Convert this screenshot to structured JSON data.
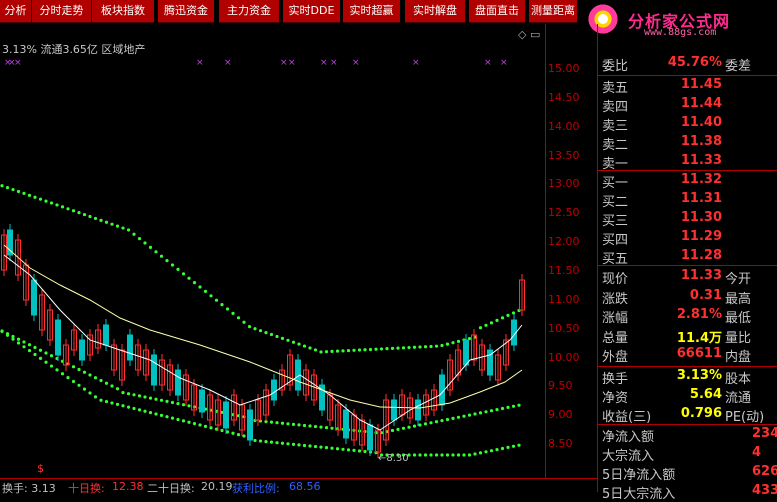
{
  "toolbar": {
    "buttons": [
      "分析",
      "分时走势",
      "板块指数",
      "腾迅资金",
      "主力资金",
      "实时DDE",
      "实时超赢",
      "实时解盘",
      "盘面直击",
      "测量距离"
    ]
  },
  "logo": {
    "title": "分析家公式网",
    "url": "www.88gs.com"
  },
  "info_line": "3.13% 流通3.65亿 区域地产",
  "axis_ticks": [
    "15.00",
    "14.50",
    "14.00",
    "13.50",
    "13.00",
    "12.50",
    "12.00",
    "11.50",
    "11.00",
    "10.50",
    "10.00",
    "9.50",
    "9.00",
    "8.50"
  ],
  "annotation": "←8.30",
  "panel": {
    "weibi": {
      "label": "委比",
      "value": "45.76%",
      "label2": "委差"
    },
    "asks": [
      {
        "label": "卖五",
        "price": "11.45"
      },
      {
        "label": "卖四",
        "price": "11.44"
      },
      {
        "label": "卖三",
        "price": "11.40"
      },
      {
        "label": "卖二",
        "price": "11.38"
      },
      {
        "label": "卖一",
        "price": "11.33"
      }
    ],
    "bids": [
      {
        "label": "买一",
        "price": "11.32"
      },
      {
        "label": "买二",
        "price": "11.31"
      },
      {
        "label": "买三",
        "price": "11.30"
      },
      {
        "label": "买四",
        "price": "11.29"
      },
      {
        "label": "买五",
        "price": "11.28"
      }
    ],
    "quote": [
      {
        "label": "现价",
        "value": "11.33",
        "label2": "今开",
        "color": "#ff3030"
      },
      {
        "label": "涨跌",
        "value": "0.31",
        "label2": "最高",
        "color": "#ff3030"
      },
      {
        "label": "涨幅",
        "value": "2.81%",
        "label2": "最低",
        "color": "#ff3030"
      },
      {
        "label": "总量",
        "value": "11.4万",
        "label2": "量比",
        "color": "#ffff00"
      },
      {
        "label": "外盘",
        "value": "66611",
        "label2": "内盘",
        "color": "#ff3030"
      }
    ],
    "fund": [
      {
        "label": "换手",
        "value": "3.13%",
        "label2": "股本",
        "color": "#ffff00"
      },
      {
        "label": "净资",
        "value": "5.64",
        "label2": "流通",
        "color": "#ffff00"
      },
      {
        "label": "收益(三)",
        "value": "0.796",
        "label2": "PE(动)",
        "color": "#ffff00"
      }
    ],
    "flow": [
      {
        "label": "净流入额",
        "value": "234"
      },
      {
        "label": "大宗流入",
        "value": "4"
      },
      {
        "label": "5日净流入额",
        "value": "626"
      },
      {
        "label": "5日大宗流入",
        "value": "433"
      }
    ]
  },
  "bottom": {
    "huanshou_label": "换手: 3.13",
    "shiri_label": "十日换:",
    "shiri_value": "12.38",
    "ershi_label": "二十日换:",
    "ershi_value": "20.19",
    "profit_label": "获利比例:",
    "profit_value": "68.56"
  },
  "colors": {
    "up": "#ff3030",
    "down": "#00c0c0",
    "band": "#33ff33",
    "ma_white": "#ffffff",
    "ma_yellow": "#ffff99",
    "marker": "#cc33ff"
  }
}
